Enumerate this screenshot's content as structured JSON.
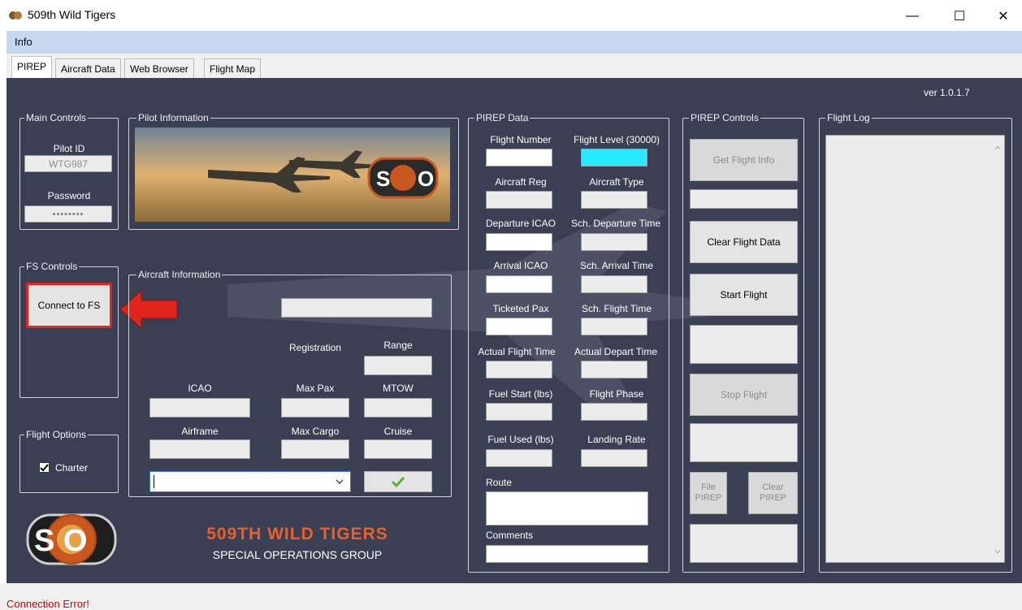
{
  "window": {
    "title": "509th Wild Tigers",
    "minimize": "—",
    "maximize": "☐",
    "close": "✕"
  },
  "menu": {
    "info": "Info"
  },
  "tabs": [
    "PIREP",
    "Aircraft Data",
    "Web Browser",
    "Flight Map"
  ],
  "version": "ver 1.0.1.7",
  "main_controls": {
    "title": "Main Controls",
    "pilot_id_label": "Pilot ID",
    "pilot_id_value": "WTG987",
    "password_label": "Password",
    "password_value": "••••••••"
  },
  "pilot_information": {
    "title": "Pilot Information"
  },
  "fs_controls": {
    "title": "FS Controls",
    "connect_label": "Connect to FS"
  },
  "flight_options": {
    "title": "Flight Options",
    "charter_label": "Charter"
  },
  "aircraft_information": {
    "title": "Aircraft Information",
    "registration_label": "Registration",
    "range_label": "Range",
    "icao_label": "ICAO",
    "max_pax_label": "Max Pax",
    "mtow_label": "MTOW",
    "airframe_label": "Airframe",
    "max_cargo_label": "Max Cargo",
    "cruise_label": "Cruise",
    "dropdown_value": ""
  },
  "pirep_data": {
    "title": "PIREP Data",
    "flight_number_label": "Flight Number",
    "flight_level_label": "Flight Level (30000)",
    "aircraft_reg_label": "Aircraft Reg",
    "aircraft_type_label": "Aircraft Type",
    "departure_icao_label": "Departure ICAO",
    "sch_departure_time_label": "Sch. Departure Time",
    "arrival_icao_label": "Arrival ICAO",
    "sch_arrival_time_label": "Sch. Arrival Time",
    "ticketed_pax_label": "Ticketed Pax",
    "sch_flight_time_label": "Sch. Flight Time",
    "actual_flight_time_label": "Actual Flight Time",
    "actual_depart_time_label": "Actual Depart Time",
    "fuel_start_label": "Fuel Start (lbs)",
    "flight_phase_label": "Flight Phase",
    "fuel_used_label": "Fuel Used (lbs)",
    "landing_rate_label": "Landing Rate",
    "route_label": "Route",
    "comments_label": "Comments"
  },
  "pirep_controls": {
    "title": "PIREP Controls",
    "get_flight_info": "Get Flight Info",
    "clear_flight_data": "Clear Flight Data",
    "start_flight": "Start Flight",
    "stop_flight": "Stop Flight",
    "file_pirep": "File PIREP",
    "clear_pirep": "Clear PIREP"
  },
  "flight_log": {
    "title": "Flight Log"
  },
  "logo": {
    "text": "S  O",
    "ring_text": "509th WILD TIGERS"
  },
  "brand": {
    "name": "509TH WILD TIGERS",
    "subtitle": "SPECIAL OPERATIONS GROUP"
  },
  "status": {
    "text": "Connection Error!"
  },
  "colors": {
    "panel": "#3a3f53",
    "accent_red": "#e0261c",
    "brand_orange": "#e8612c",
    "cyan": "#27e9ff"
  }
}
